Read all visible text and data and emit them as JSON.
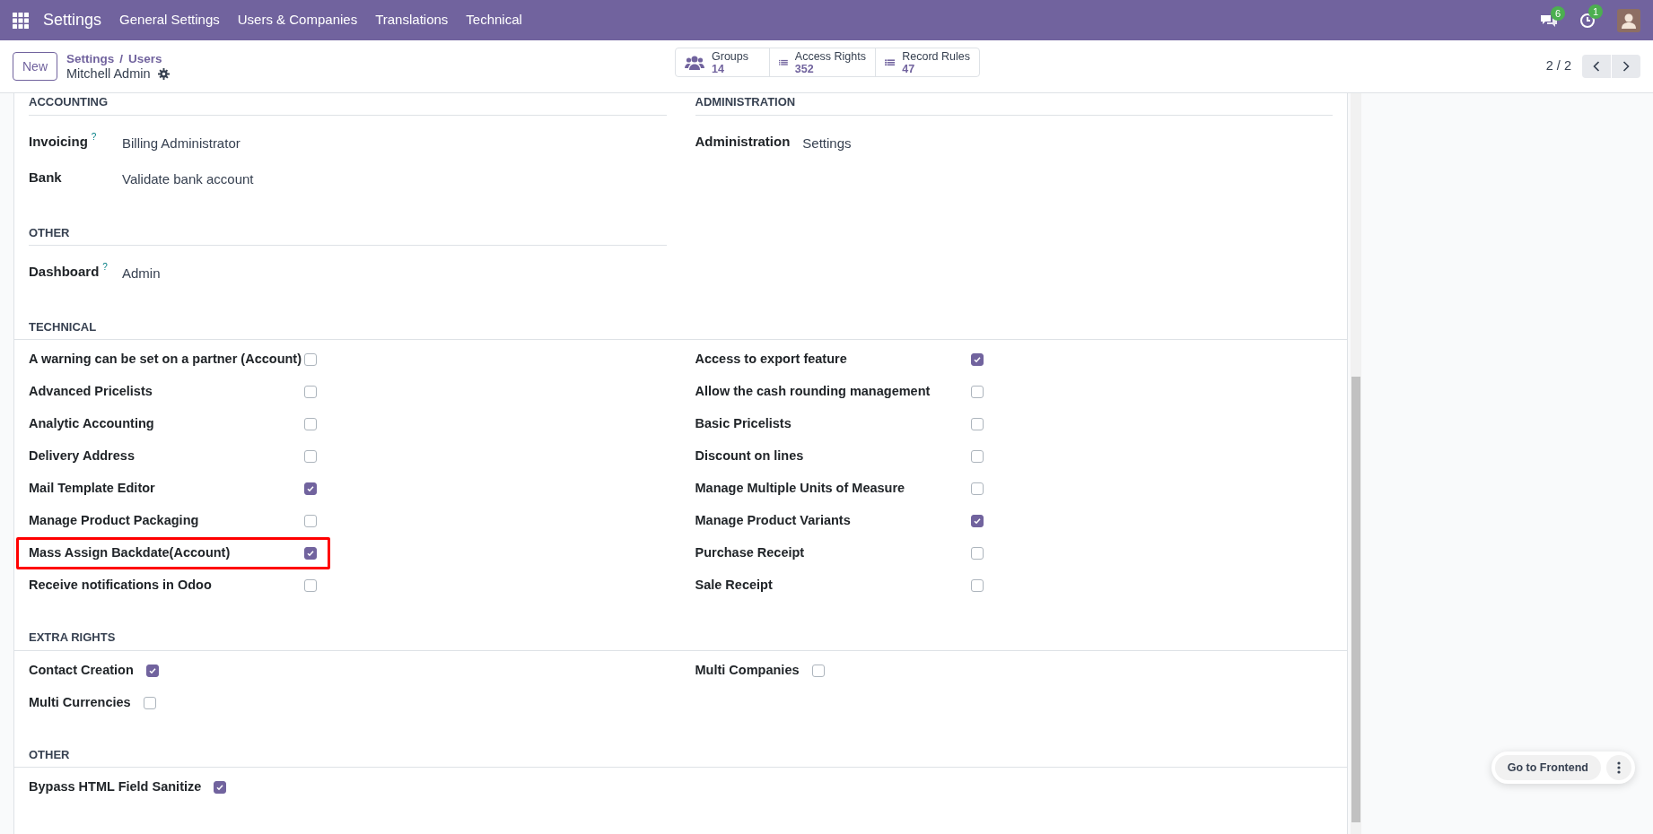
{
  "topbar": {
    "app": "Settings",
    "menu": [
      "General Settings",
      "Users & Companies",
      "Translations",
      "Technical"
    ],
    "messages_count": "6",
    "activities_count": "1"
  },
  "control_panel": {
    "new_button": "New",
    "breadcrumb": [
      "Settings",
      "Users"
    ],
    "breadcrumb_separator": "/",
    "record_title": "Mitchell Admin",
    "smart_buttons": [
      {
        "kind": "groups",
        "label": "Groups",
        "value": "14"
      },
      {
        "kind": "list",
        "label": "Access Rights",
        "value": "352"
      },
      {
        "kind": "rules",
        "label": "Record Rules",
        "value": "47"
      }
    ],
    "pager": "2 / 2"
  },
  "top_groups": {
    "left": [
      {
        "title": "ACCOUNTING",
        "fields": [
          {
            "label": "Invoicing",
            "help": "?",
            "value": "Billing Administrator"
          },
          {
            "label": "Bank",
            "value": "Validate bank account"
          }
        ]
      },
      {
        "title": "OTHER",
        "fields": [
          {
            "label": "Dashboard",
            "help": "?",
            "value": "Admin"
          }
        ]
      }
    ],
    "right": [
      {
        "title": "ADMINISTRATION",
        "fields": [
          {
            "label": "Administration",
            "value": "Settings"
          }
        ]
      }
    ]
  },
  "check_sections": [
    {
      "title": "TECHNICAL",
      "kind": "aligned",
      "left": [
        {
          "label": "A warning can be set on a partner (Account)",
          "checked": false,
          "highlighted": false
        },
        {
          "label": "Advanced Pricelists",
          "checked": false,
          "highlighted": false
        },
        {
          "label": "Analytic Accounting",
          "checked": false,
          "highlighted": false
        },
        {
          "label": "Delivery Address",
          "checked": false,
          "highlighted": false
        },
        {
          "label": "Mail Template Editor",
          "checked": true,
          "highlighted": false
        },
        {
          "label": "Manage Product Packaging",
          "checked": false,
          "highlighted": false
        },
        {
          "label": "Mass Assign Backdate(Account)",
          "checked": true,
          "highlighted": true
        },
        {
          "label": "Receive notifications in Odoo",
          "checked": false,
          "highlighted": false
        }
      ],
      "right": [
        {
          "label": "Access to export feature",
          "checked": true,
          "highlighted": false
        },
        {
          "label": "Allow the cash rounding management",
          "checked": false,
          "highlighted": false
        },
        {
          "label": "Basic Pricelists",
          "checked": false,
          "highlighted": false
        },
        {
          "label": "Discount on lines",
          "checked": false,
          "highlighted": false
        },
        {
          "label": "Manage Multiple Units of Measure",
          "checked": false,
          "highlighted": false
        },
        {
          "label": "Manage Product Variants",
          "checked": true,
          "highlighted": false
        },
        {
          "label": "Purchase Receipt",
          "checked": false,
          "highlighted": false
        },
        {
          "label": "Sale Receipt",
          "checked": false,
          "highlighted": false
        }
      ]
    },
    {
      "title": "EXTRA RIGHTS",
      "kind": "inline",
      "left": [
        {
          "label": "Contact Creation",
          "checked": true,
          "highlighted": false
        },
        {
          "label": "Multi Currencies",
          "checked": false,
          "highlighted": false
        }
      ],
      "right": [
        {
          "label": "Multi Companies",
          "checked": false,
          "highlighted": false
        }
      ]
    },
    {
      "title": "OTHER",
      "kind": "inline",
      "left": [
        {
          "label": "Bypass HTML Field Sanitize",
          "checked": true,
          "highlighted": false
        }
      ]
    }
  ],
  "frontend_button": "Go to Frontend"
}
